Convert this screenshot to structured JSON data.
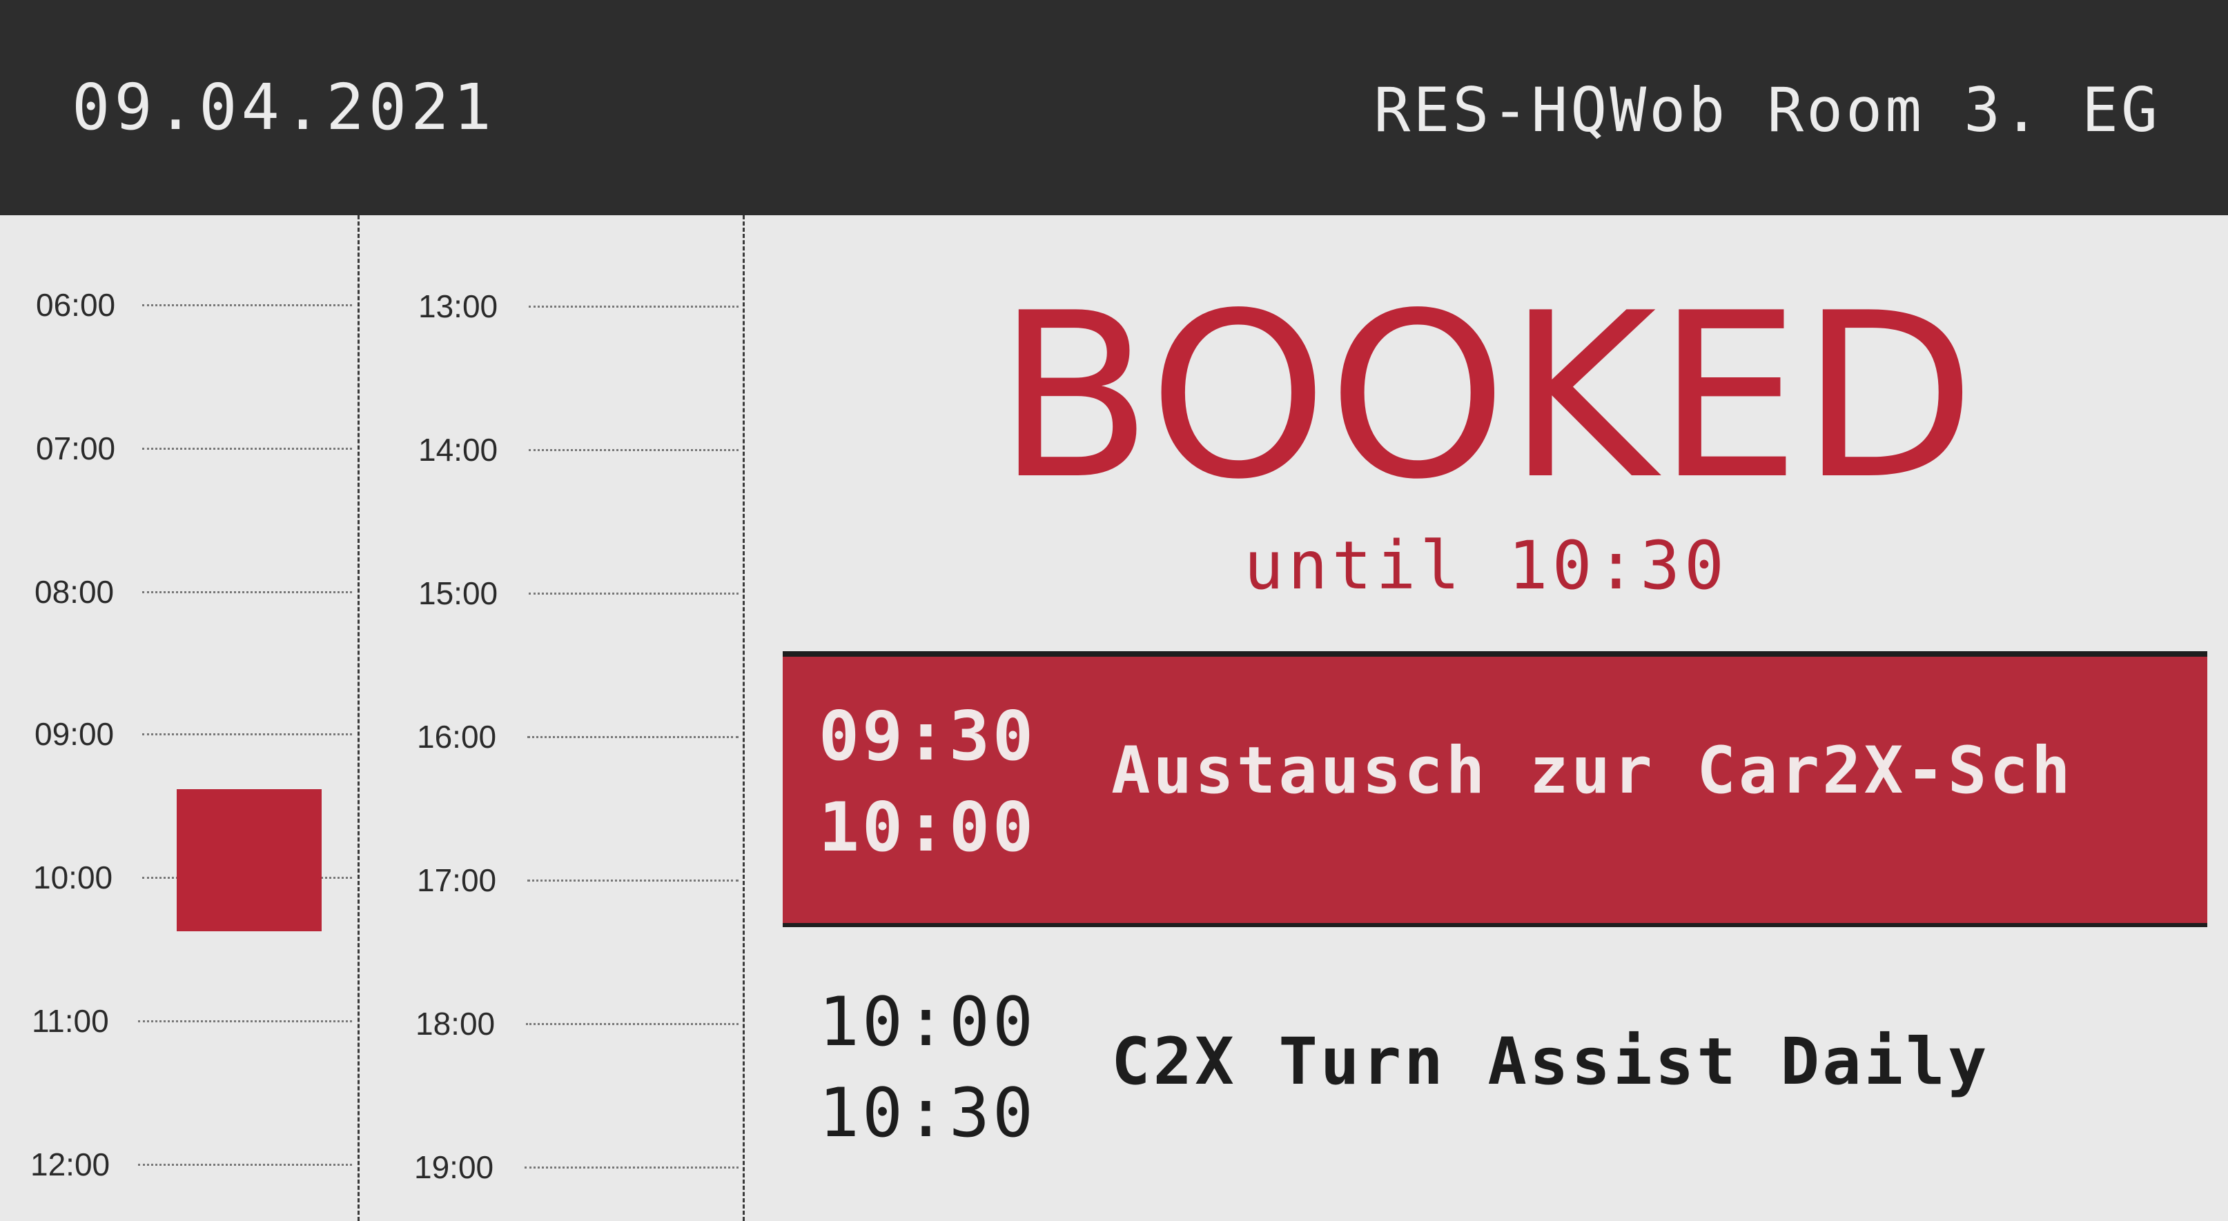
{
  "header": {
    "date": "09.04.2021",
    "room": "RES-HQWob Room 3. EG"
  },
  "timeline": {
    "left_hours": [
      "06:00",
      "07:00",
      "08:00",
      "09:00",
      "10:00",
      "11:00",
      "12:00"
    ],
    "right_hours": [
      "13:00",
      "14:00",
      "15:00",
      "16:00",
      "17:00",
      "18:00",
      "19:00"
    ]
  },
  "status": {
    "label": "BOOKED",
    "until": "until 10:30"
  },
  "events": [
    {
      "start": "09:30",
      "end": "10:00",
      "title": "Austausch zur Car2X-Sch",
      "current": true
    },
    {
      "start": "10:00",
      "end": "10:30",
      "title": "C2X Turn Assist Daily",
      "current": false
    }
  ],
  "colors": {
    "header_bg": "#2d2d2d",
    "accent": "#b82637",
    "background": "#e9e9e9"
  }
}
